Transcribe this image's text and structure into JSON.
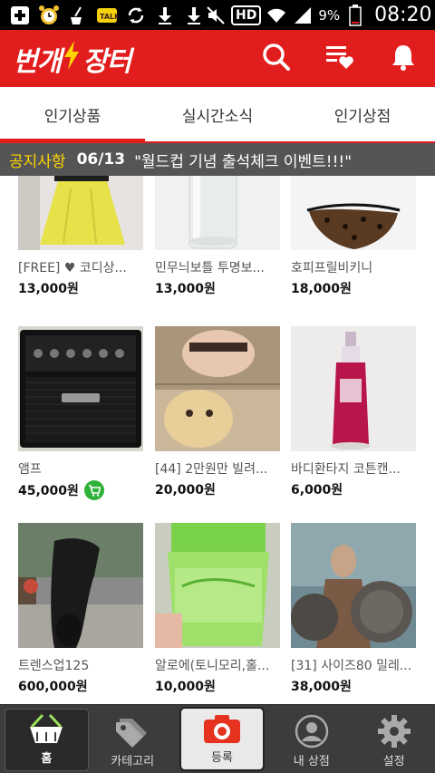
{
  "status_bar": {
    "battery_pct": "9%",
    "time": "08:20",
    "hd_label": "HD",
    "icons": [
      "add-icon",
      "alarm-clock-icon",
      "clean-icon",
      "talk-icon",
      "sync-icon",
      "download-icon",
      "download-icon",
      "mute-icon",
      "hd-voice-icon",
      "wifi-icon",
      "signal-icon",
      "battery-icon"
    ]
  },
  "header": {
    "logo_left": "번개",
    "logo_right": "장터",
    "icons": [
      "search-icon",
      "wishlist-icon",
      "bell-icon"
    ],
    "accent": "#e21d1d"
  },
  "tabs": [
    {
      "label": "인기상품",
      "active": true
    },
    {
      "label": "실시간소식",
      "active": false
    },
    {
      "label": "인기상점",
      "active": false
    }
  ],
  "notice": {
    "label": "공지사항",
    "date": "06/13",
    "text": "\"월드컵 기념 출석체크 이벤트!!!\""
  },
  "products": [
    {
      "name": "[FREE] ♥ 코디상...",
      "price": "13,000원",
      "thumb": "yellow-skirt",
      "cart": false
    },
    {
      "name": "민무늬보틀 투명보...",
      "price": "13,000원",
      "thumb": "clear-bottle",
      "cart": false
    },
    {
      "name": "호피프릴비키니",
      "price": "18,000원",
      "thumb": "leopard-bikini",
      "cart": false
    },
    {
      "name": "앰프",
      "price": "45,000원",
      "thumb": "amp",
      "cart": true
    },
    {
      "name": "[44] 2만원만 빌려...",
      "price": "20,000원",
      "thumb": "meme",
      "cart": false
    },
    {
      "name": "바디환타지 코튼캔...",
      "price": "6,000원",
      "thumb": "body-spray",
      "cart": false
    },
    {
      "name": "트렌스업125",
      "price": "600,000원",
      "thumb": "scooter",
      "cart": false
    },
    {
      "name": "알로에(토니모리,홀...",
      "price": "10,000원",
      "thumb": "aloe-jar",
      "cart": false
    },
    {
      "name": "[31] 사이즈80 밀레...",
      "price": "38,000원",
      "thumb": "spartan",
      "cart": false
    }
  ],
  "bottom_nav": [
    {
      "label": "홈",
      "icon": "home-basket-icon",
      "active": true
    },
    {
      "label": "카테고리",
      "icon": "tags-icon",
      "active": false
    },
    {
      "label": "등록",
      "icon": "camera-icon",
      "active": false
    },
    {
      "label": "내 상점",
      "icon": "profile-icon",
      "active": false
    },
    {
      "label": "설정",
      "icon": "gear-icon",
      "active": false
    }
  ]
}
